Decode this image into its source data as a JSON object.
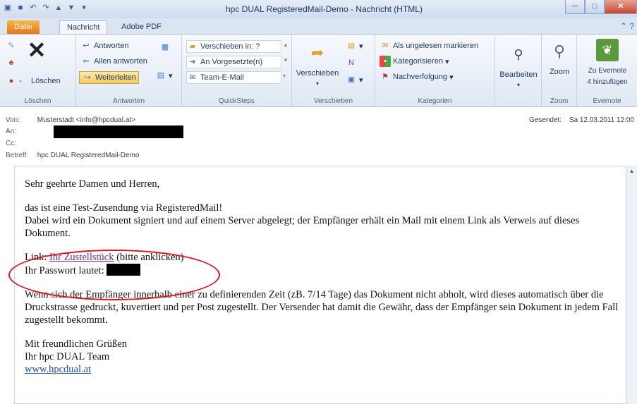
{
  "window": {
    "title": "hpc DUAL RegisteredMail-Demo  -  Nachricht (HTML)"
  },
  "tabs": [
    "Datei",
    "Nachricht",
    "Adobe PDF"
  ],
  "ribbon": {
    "loeschen": {
      "button": "Löschen",
      "label": "Löschen"
    },
    "antworten": {
      "reply": "Antworten",
      "reply_all": "Allen antworten",
      "forward": "Weiterleiten",
      "label": "Antworten"
    },
    "quicksteps": {
      "items": [
        "Verschieben in: ?",
        "An Vorgesetzte(n)",
        "Team-E-Mail"
      ],
      "label": "QuickSteps"
    },
    "verschieben": {
      "button": "Verschieben",
      "label": "Verschieben"
    },
    "kategorien": {
      "unread": "Als ungelesen markieren",
      "categorize": "Kategorisieren",
      "followup": "Nachverfolgung",
      "label": "Kategorien"
    },
    "bearbeiten": {
      "button": "Bearbeiten"
    },
    "zoom": {
      "button": "Zoom",
      "label": "Zoom"
    },
    "evernote": {
      "button_line1": "Zu Evernote",
      "button_line2": "4 hinzufügen",
      "label": "Evernote"
    }
  },
  "header": {
    "from_label": "Von:",
    "from_value": "Musterstadt <info@hpcdual.at>",
    "to_label": "An:",
    "cc_label": "Cc:",
    "subject_label": "Betreff:",
    "subject_value": "hpc DUAL RegisteredMail-Demo",
    "sent_label": "Gesendet:",
    "sent_value": "Sa 12.03.2011 12:00"
  },
  "body": {
    "greeting": "Sehr geehrte Damen und Herren,",
    "para1_line1": "das ist eine Test-Zusendung via RegisteredMail!",
    "para1_line2": "Dabei wird ein Dokument signiert und auf einem Server abgelegt; der Empfänger erhält ein Mail mit einem Link als Verweis auf dieses Dokument.",
    "link_prefix": "Link: ",
    "link_text": "Ihr Zustellstück",
    "link_suffix": " (bitte anklicken)",
    "password_label": "Ihr Passwort lautet: ",
    "para3": "Wenn sich der Empfänger innerhalb einer zu definierenden Zeit (zB. 7/14 Tage) das Dokument nicht abholt, wird dieses automatisch über die Druckstrasse gedruckt, kuvertiert und per Post zugestellt. Der Versender hat damit die Gewähr, dass der Empfänger sein Dokument in jedem Fall zugestellt bekommt.",
    "closing": "Mit freundlichen Grüßen",
    "team": "Ihr hpc DUAL Team",
    "website": "www.hpcdual.at"
  },
  "colors": {
    "annotation_circle": "#e3111e",
    "link_visited": "#6b2fa0",
    "file_tab": "#e5761b"
  }
}
